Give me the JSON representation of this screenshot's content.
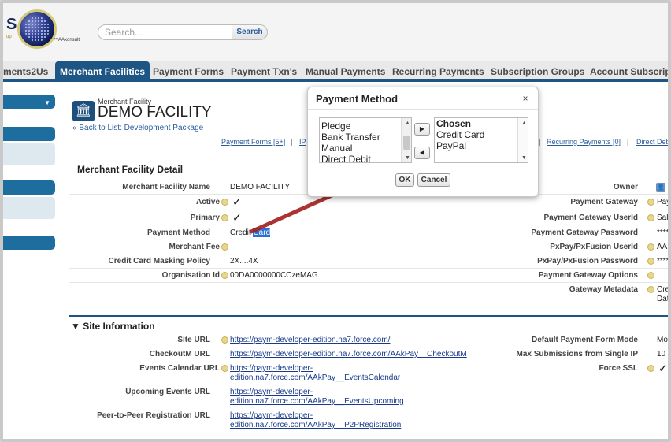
{
  "header": {
    "logo_letter": "S",
    "logo_small": "up",
    "logo_tag": "™AAkonsult",
    "search_placeholder": "Search...",
    "search_button": "Search"
  },
  "tabs": [
    "ments2Us",
    "Merchant Facilities",
    "Payment Forms",
    "Payment Txn's",
    "Manual Payments",
    "Recurring Payments",
    "Subscription Groups",
    "Account Subscripti"
  ],
  "page": {
    "subtitle": "Merchant Facility",
    "title": "DEMO FACILITY",
    "back_link": "« Back to List: Development Package",
    "related": [
      "Payment Forms [5+]",
      "IP",
      "Recurring Payments [0]",
      "Direct Deb"
    ]
  },
  "detail": {
    "section_title": "Merchant Facility Detail",
    "left": [
      {
        "label": "Merchant Facility Name",
        "value": "DEMO FACILITY"
      },
      {
        "label": "Active",
        "value": "✓"
      },
      {
        "label": "Primary",
        "value": "✓"
      },
      {
        "label": "Payment Method",
        "value_a": "Credit ",
        "value_b": "Card"
      },
      {
        "label": "Merchant Fee",
        "value": ""
      },
      {
        "label": "Credit Card Masking Policy",
        "value": "2X....4X"
      },
      {
        "label": "Organisation Id",
        "value": "00DA0000000CCzeMAG"
      }
    ],
    "right": [
      {
        "label": "Owner",
        "value": ""
      },
      {
        "label": "Payment Gateway",
        "value": "Pay"
      },
      {
        "label": "Payment Gateway UserId",
        "value": "Sal"
      },
      {
        "label": "Payment Gateway Password",
        "value": "****"
      },
      {
        "label": "PxPay/PxFusion UserId",
        "value": "AAK"
      },
      {
        "label": "PxPay/PxFusion Password",
        "value": "****"
      },
      {
        "label": "Payment Gateway Options",
        "value": ""
      },
      {
        "label": "Gateway Metadata",
        "value": "Cre",
        "value2": "Dat"
      }
    ]
  },
  "site": {
    "section_title": "Site Information",
    "left": [
      {
        "label": "Site URL",
        "value": "https://paym-developer-edition.na7.force.com/"
      },
      {
        "label": "CheckoutM URL",
        "value": "https://paym-developer-edition.na7.force.com/AAkPay__CheckoutM"
      },
      {
        "label": "Events Calendar URL",
        "value": "https://paym-developer-",
        "value2": "edition.na7.force.com/AAkPay__EventsCalendar"
      },
      {
        "label": "Upcoming Events URL",
        "value": "https://paym-developer-",
        "value2": "edition.na7.force.com/AAkPay__EventsUpcoming"
      },
      {
        "label": "Peer-to-Peer Registration URL",
        "value": "https://paym-developer-",
        "value2": "edition.na7.force.com/AAkPay__P2PRegistration"
      }
    ],
    "right": [
      {
        "label": "Default Payment Form Mode",
        "value": "Mo"
      },
      {
        "label": "Max Submissions from Single IP",
        "value": "10"
      },
      {
        "label": "Force SSL",
        "value": "✓"
      }
    ]
  },
  "modal": {
    "title": "Payment Method",
    "close": "×",
    "available": [
      "Pledge",
      "Bank Transfer",
      "Manual",
      "Direct Debit"
    ],
    "chosen_header": "Chosen",
    "chosen": [
      "Credit Card",
      "PayPal"
    ],
    "add_arrow": "▶",
    "remove_arrow": "◀",
    "ok": "OK",
    "cancel": "Cancel"
  },
  "colors": {
    "tab_active": "#1d5585",
    "link": "#1a3a8a",
    "selection": "#2b6fd1",
    "annotation_arrow": "#a31d1d"
  }
}
